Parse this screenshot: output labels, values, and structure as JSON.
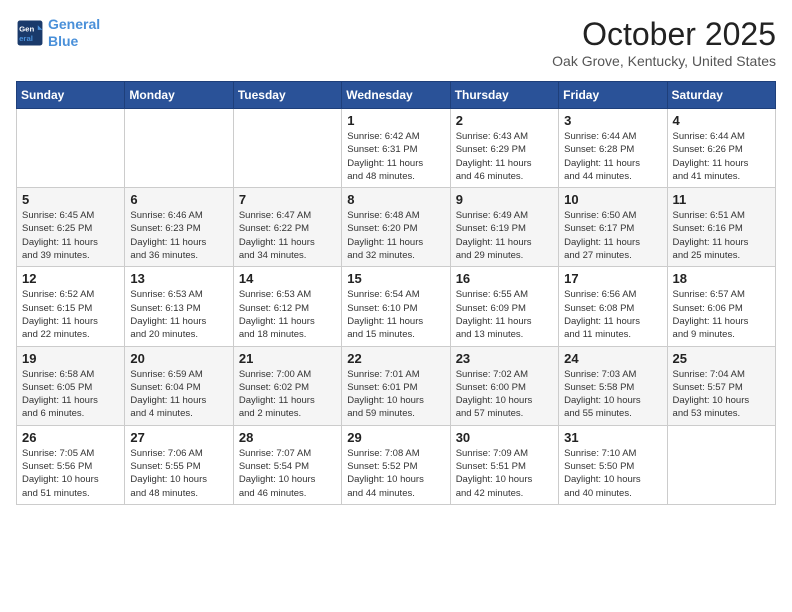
{
  "header": {
    "logo_line1": "General",
    "logo_line2": "Blue",
    "month_title": "October 2025",
    "location": "Oak Grove, Kentucky, United States"
  },
  "weekdays": [
    "Sunday",
    "Monday",
    "Tuesday",
    "Wednesday",
    "Thursday",
    "Friday",
    "Saturday"
  ],
  "weeks": [
    [
      {
        "day": "",
        "info": ""
      },
      {
        "day": "",
        "info": ""
      },
      {
        "day": "",
        "info": ""
      },
      {
        "day": "1",
        "info": "Sunrise: 6:42 AM\nSunset: 6:31 PM\nDaylight: 11 hours\nand 48 minutes."
      },
      {
        "day": "2",
        "info": "Sunrise: 6:43 AM\nSunset: 6:29 PM\nDaylight: 11 hours\nand 46 minutes."
      },
      {
        "day": "3",
        "info": "Sunrise: 6:44 AM\nSunset: 6:28 PM\nDaylight: 11 hours\nand 44 minutes."
      },
      {
        "day": "4",
        "info": "Sunrise: 6:44 AM\nSunset: 6:26 PM\nDaylight: 11 hours\nand 41 minutes."
      }
    ],
    [
      {
        "day": "5",
        "info": "Sunrise: 6:45 AM\nSunset: 6:25 PM\nDaylight: 11 hours\nand 39 minutes."
      },
      {
        "day": "6",
        "info": "Sunrise: 6:46 AM\nSunset: 6:23 PM\nDaylight: 11 hours\nand 36 minutes."
      },
      {
        "day": "7",
        "info": "Sunrise: 6:47 AM\nSunset: 6:22 PM\nDaylight: 11 hours\nand 34 minutes."
      },
      {
        "day": "8",
        "info": "Sunrise: 6:48 AM\nSunset: 6:20 PM\nDaylight: 11 hours\nand 32 minutes."
      },
      {
        "day": "9",
        "info": "Sunrise: 6:49 AM\nSunset: 6:19 PM\nDaylight: 11 hours\nand 29 minutes."
      },
      {
        "day": "10",
        "info": "Sunrise: 6:50 AM\nSunset: 6:17 PM\nDaylight: 11 hours\nand 27 minutes."
      },
      {
        "day": "11",
        "info": "Sunrise: 6:51 AM\nSunset: 6:16 PM\nDaylight: 11 hours\nand 25 minutes."
      }
    ],
    [
      {
        "day": "12",
        "info": "Sunrise: 6:52 AM\nSunset: 6:15 PM\nDaylight: 11 hours\nand 22 minutes."
      },
      {
        "day": "13",
        "info": "Sunrise: 6:53 AM\nSunset: 6:13 PM\nDaylight: 11 hours\nand 20 minutes."
      },
      {
        "day": "14",
        "info": "Sunrise: 6:53 AM\nSunset: 6:12 PM\nDaylight: 11 hours\nand 18 minutes."
      },
      {
        "day": "15",
        "info": "Sunrise: 6:54 AM\nSunset: 6:10 PM\nDaylight: 11 hours\nand 15 minutes."
      },
      {
        "day": "16",
        "info": "Sunrise: 6:55 AM\nSunset: 6:09 PM\nDaylight: 11 hours\nand 13 minutes."
      },
      {
        "day": "17",
        "info": "Sunrise: 6:56 AM\nSunset: 6:08 PM\nDaylight: 11 hours\nand 11 minutes."
      },
      {
        "day": "18",
        "info": "Sunrise: 6:57 AM\nSunset: 6:06 PM\nDaylight: 11 hours\nand 9 minutes."
      }
    ],
    [
      {
        "day": "19",
        "info": "Sunrise: 6:58 AM\nSunset: 6:05 PM\nDaylight: 11 hours\nand 6 minutes."
      },
      {
        "day": "20",
        "info": "Sunrise: 6:59 AM\nSunset: 6:04 PM\nDaylight: 11 hours\nand 4 minutes."
      },
      {
        "day": "21",
        "info": "Sunrise: 7:00 AM\nSunset: 6:02 PM\nDaylight: 11 hours\nand 2 minutes."
      },
      {
        "day": "22",
        "info": "Sunrise: 7:01 AM\nSunset: 6:01 PM\nDaylight: 10 hours\nand 59 minutes."
      },
      {
        "day": "23",
        "info": "Sunrise: 7:02 AM\nSunset: 6:00 PM\nDaylight: 10 hours\nand 57 minutes."
      },
      {
        "day": "24",
        "info": "Sunrise: 7:03 AM\nSunset: 5:58 PM\nDaylight: 10 hours\nand 55 minutes."
      },
      {
        "day": "25",
        "info": "Sunrise: 7:04 AM\nSunset: 5:57 PM\nDaylight: 10 hours\nand 53 minutes."
      }
    ],
    [
      {
        "day": "26",
        "info": "Sunrise: 7:05 AM\nSunset: 5:56 PM\nDaylight: 10 hours\nand 51 minutes."
      },
      {
        "day": "27",
        "info": "Sunrise: 7:06 AM\nSunset: 5:55 PM\nDaylight: 10 hours\nand 48 minutes."
      },
      {
        "day": "28",
        "info": "Sunrise: 7:07 AM\nSunset: 5:54 PM\nDaylight: 10 hours\nand 46 minutes."
      },
      {
        "day": "29",
        "info": "Sunrise: 7:08 AM\nSunset: 5:52 PM\nDaylight: 10 hours\nand 44 minutes."
      },
      {
        "day": "30",
        "info": "Sunrise: 7:09 AM\nSunset: 5:51 PM\nDaylight: 10 hours\nand 42 minutes."
      },
      {
        "day": "31",
        "info": "Sunrise: 7:10 AM\nSunset: 5:50 PM\nDaylight: 10 hours\nand 40 minutes."
      },
      {
        "day": "",
        "info": ""
      }
    ]
  ]
}
